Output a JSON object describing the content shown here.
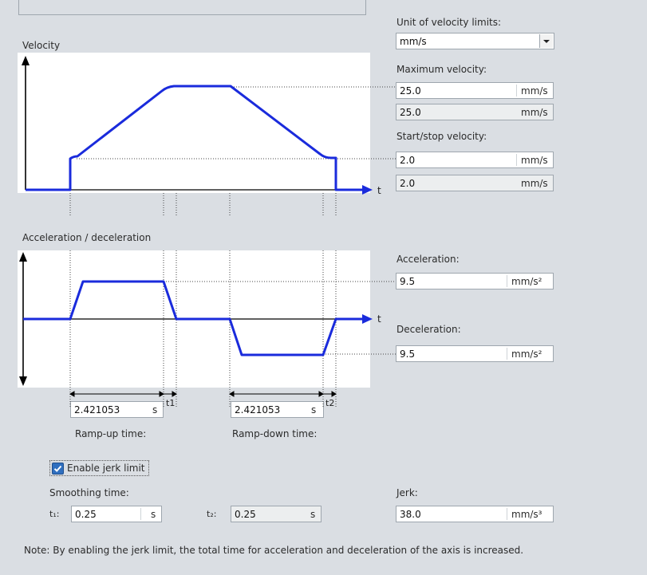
{
  "velocity_panel": {
    "section_label": "Velocity",
    "axis_label": "t",
    "unit_label": "Unit of velocity limits:",
    "unit_selected": "mm/s",
    "max_velocity_label": "Maximum velocity:",
    "max_velocity_value": "25.0",
    "max_velocity_unit": "mm/s",
    "max_velocity_readonly_value": "25.0",
    "max_velocity_readonly_unit": "mm/s",
    "start_stop_label": "Start/stop velocity:",
    "start_stop_value": "2.0",
    "start_stop_unit": "mm/s",
    "start_stop_readonly_value": "2.0",
    "start_stop_readonly_unit": "mm/s"
  },
  "acceleration_panel": {
    "section_label": "Acceleration / deceleration",
    "axis_label": "t",
    "acceleration_label": "Acceleration:",
    "acceleration_value": "9.5",
    "acceleration_unit": "mm/s²",
    "deceleration_label": "Deceleration:",
    "deceleration_value": "9.5",
    "deceleration_unit": "mm/s²",
    "ramp_up_value": "2.421053",
    "ramp_up_unit": "s",
    "ramp_up_label": "Ramp-up time:",
    "ramp_down_value": "2.421053",
    "ramp_down_unit": "s",
    "ramp_down_label": "Ramp-down time:",
    "t1_marker": "t1",
    "t2_marker": "t2"
  },
  "jerk": {
    "enable_label": "Enable jerk limit",
    "enabled": true,
    "smoothing_label": "Smoothing time:",
    "t1_label": "t₁:",
    "t1_value": "0.25",
    "t1_unit": "s",
    "t2_label": "t₂:",
    "t2_value": "0.25",
    "t2_unit": "s",
    "jerk_label": "Jerk:",
    "jerk_value": "38.0",
    "jerk_unit": "mm/s³"
  },
  "note": "Note: By enabling the jerk limit, the total time for acceleration and deceleration of the axis is increased.",
  "colors": {
    "background": "#dadee3",
    "curve": "#1a2bdc",
    "axis": "#000000",
    "guide": "#333333",
    "check_accent": "#2f6fbf"
  }
}
